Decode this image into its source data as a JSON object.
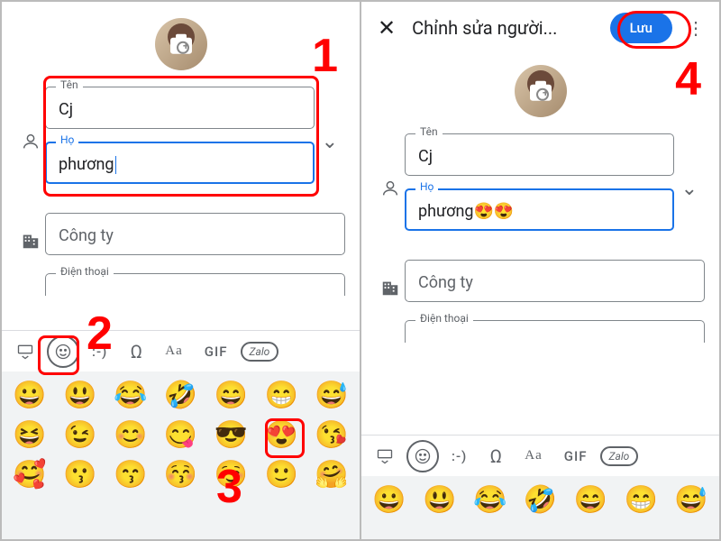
{
  "left": {
    "ten_label": "Tên",
    "ten_value": "Cj",
    "ho_label": "Họ",
    "ho_value": "phương",
    "congty_label": "Công ty",
    "dienthoai_label": "Điện thoại"
  },
  "right": {
    "title": "Chỉnh sửa người...",
    "save_label": "Lưu",
    "ten_label": "Tên",
    "ten_value": "Cj",
    "ho_label": "Họ",
    "ho_value": "phương😍😍",
    "congty_label": "Công ty",
    "dienthoai_label": "Điện thoại"
  },
  "kbd": {
    "emoticon": ":-)",
    "omega": "Ω",
    "aa": "Aa",
    "gif": "GIF",
    "zalo": "Zalo"
  },
  "emoji_rows": [
    [
      "😀",
      "😃",
      "😂",
      "🤣",
      "😄",
      "😁",
      "😅"
    ],
    [
      "😆",
      "😉",
      "😊",
      "😋",
      "😎",
      "😍",
      "😘"
    ],
    [
      "🥰",
      "😗",
      "😙",
      "😚",
      "☺️",
      "🙂",
      "🤗"
    ]
  ],
  "emoji_rows_right": [
    [
      "😀",
      "😃",
      "😂",
      "🤣",
      "😄",
      "😁",
      "😅"
    ]
  ],
  "steps": {
    "s1": "1",
    "s2": "2",
    "s3": "3",
    "s4": "4"
  }
}
